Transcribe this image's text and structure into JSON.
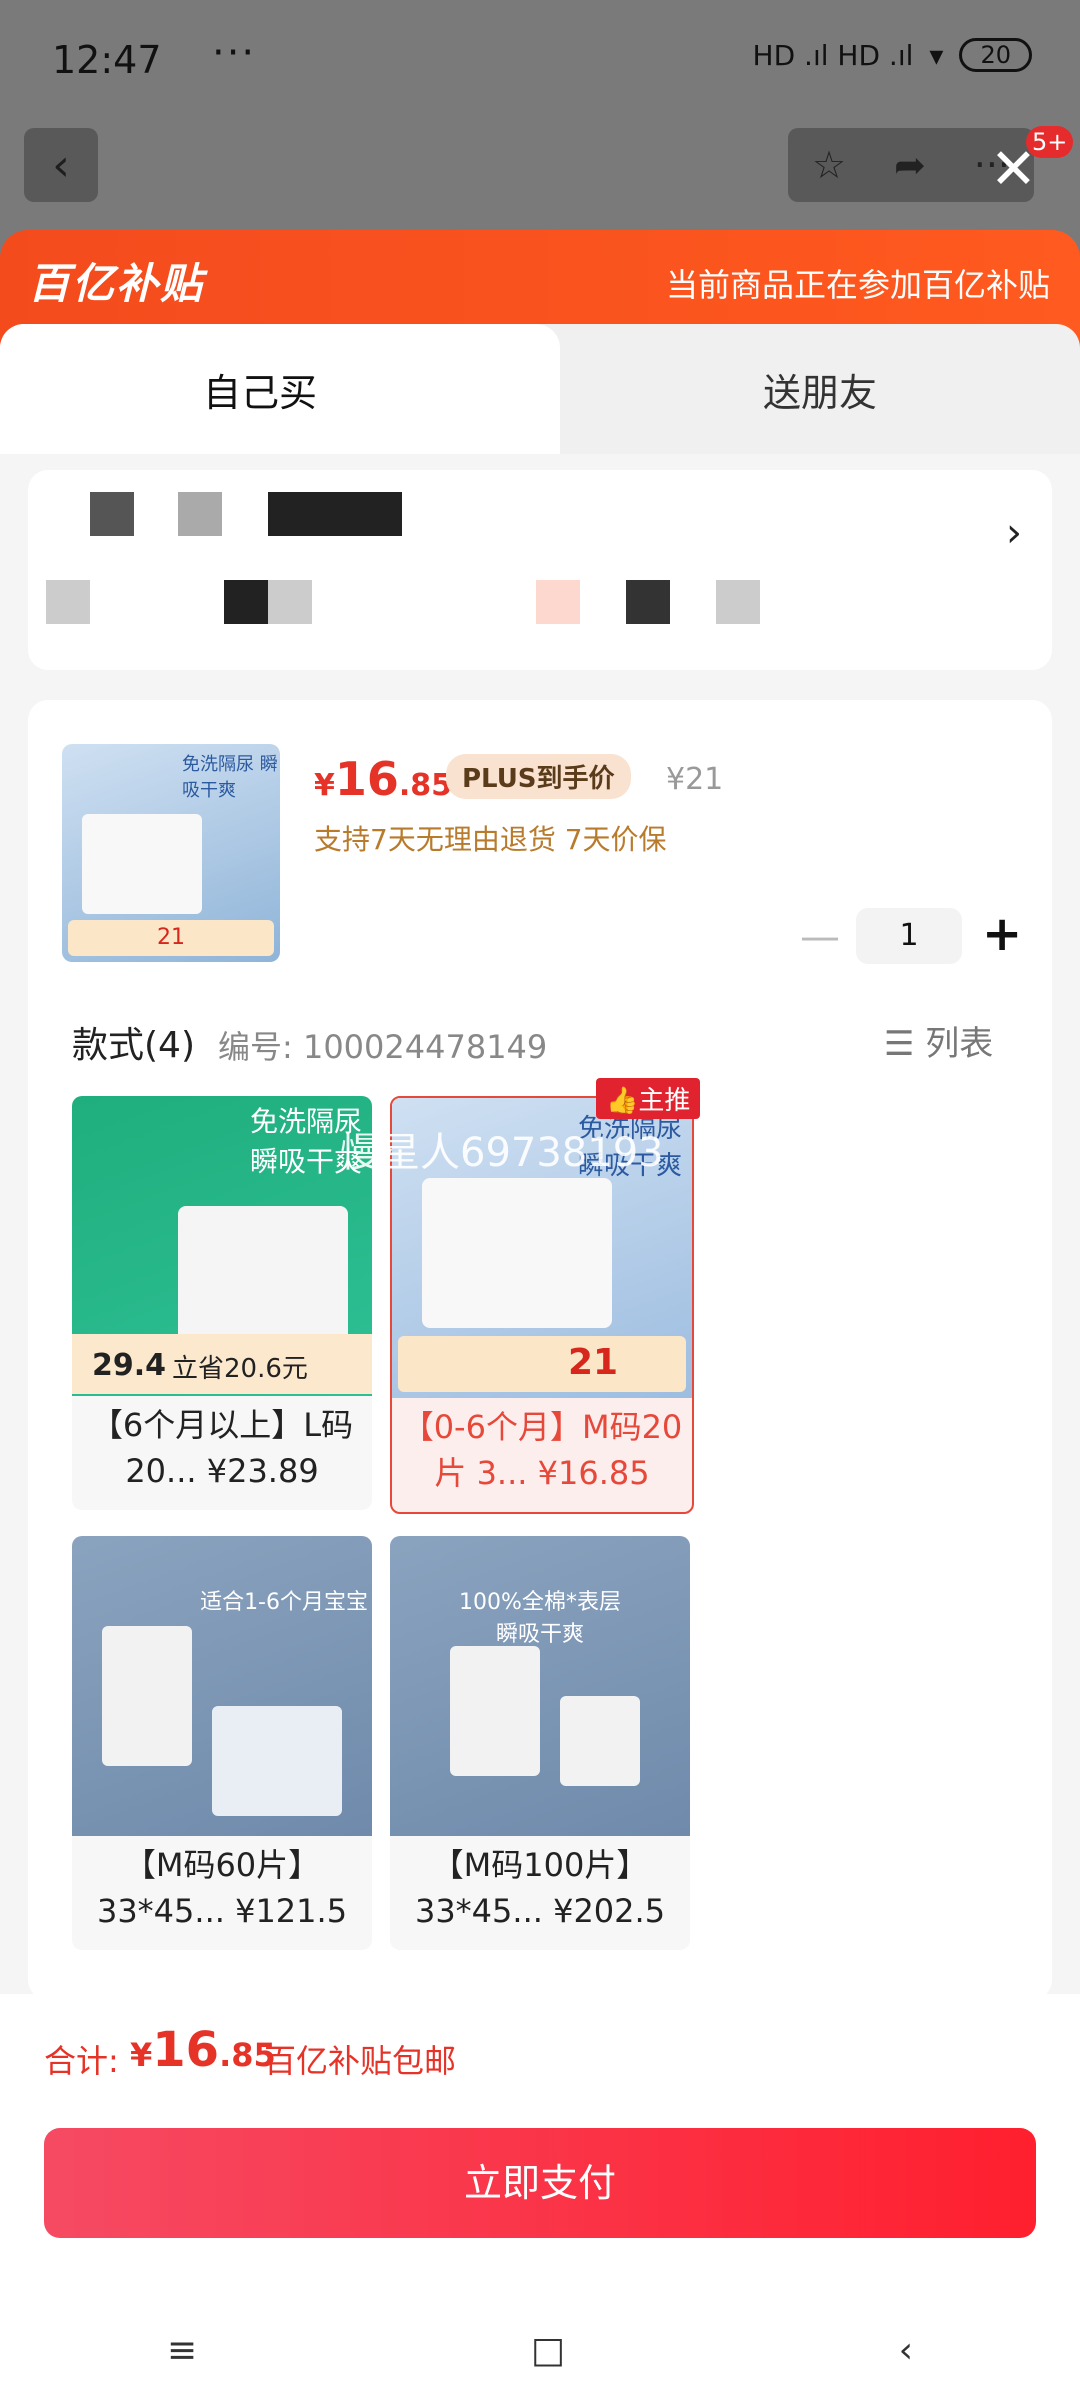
{
  "status": {
    "time": "12:47",
    "more": "···",
    "signal": "HD .ıl HD .ıl",
    "battery": "20"
  },
  "header": {
    "badge": "5+"
  },
  "banner": {
    "logo": "百亿补贴",
    "note": "当前商品正在参加百亿补贴"
  },
  "tabs": [
    {
      "label": "自己买"
    },
    {
      "label": "送朋友"
    }
  ],
  "product": {
    "thumb_text": "免洗隔尿 瞬吸干爽",
    "thumb_price": "21",
    "price_symbol": "¥",
    "price_int": "16",
    "price_dec": ".85",
    "plus_tag": "PLUS到手价",
    "orig_price": "¥21",
    "service": "支持7天无理由退货  7天价保",
    "quantity": "1"
  },
  "styles": {
    "title": "款式(4)",
    "code": "编号: 100024478149",
    "list_label": "列表",
    "items": [
      {
        "label": "【6个月以上】L码20... ¥23.89",
        "img_text": "免洗隔尿 瞬吸干爽",
        "promo": "立省20.6元",
        "promo_price": "29.4"
      },
      {
        "label": "【0-6个月】M码20片 3... ¥16.85",
        "img_text": "免洗隔尿 瞬吸干爽",
        "promo_price": "21",
        "badge": "主推"
      },
      {
        "label": "【M码60片】33*45... ¥121.5",
        "img_text": "适合1-6个月宝宝"
      },
      {
        "label": "【M码100片】33*45... ¥202.5",
        "img_text": "100%全棉*表层 瞬吸干爽"
      }
    ]
  },
  "watermark": "慢星人69738193",
  "total": {
    "label": "合计:",
    "symbol": "¥",
    "int": "16",
    "dec": ".85",
    "shipping": "百亿补贴包邮"
  },
  "pay_button": "立即支付"
}
